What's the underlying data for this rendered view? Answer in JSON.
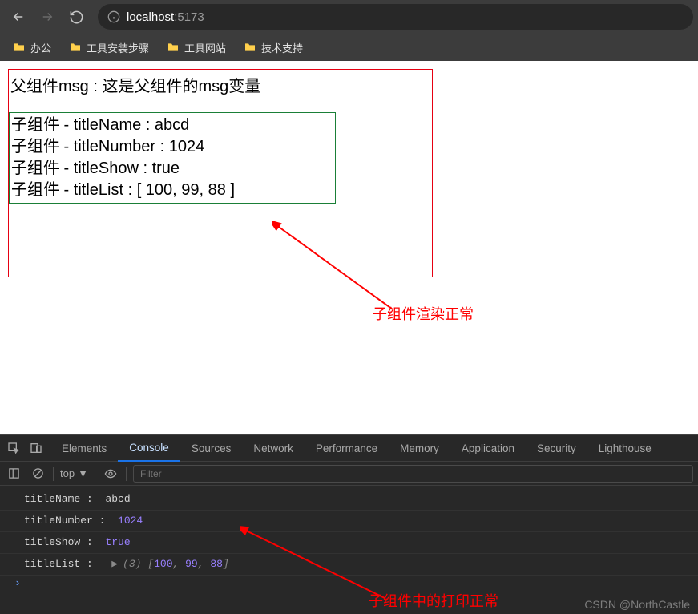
{
  "url": {
    "host": "localhost",
    "port": ":5173"
  },
  "bookmarks": [
    "办公",
    "工具安装步骤",
    "工具网站",
    "技术支持"
  ],
  "page": {
    "parent": "父组件msg : 这是父组件的msg变量",
    "child": {
      "line1": "子组件 - titleName : abcd",
      "line2": "子组件 - titleNumber : 1024",
      "line3": "子组件 - titleShow : true",
      "line4": "子组件 - titleList : [ 100, 99, 88 ]"
    },
    "annot1": "子组件渲染正常"
  },
  "devtools": {
    "tabs": [
      "Elements",
      "Console",
      "Sources",
      "Network",
      "Performance",
      "Memory",
      "Application",
      "Security",
      "Lighthouse"
    ],
    "activeTab": 1,
    "topLabel": "top",
    "filterPlaceholder": "Filter",
    "logs": {
      "r1": {
        "k": "titleName :",
        "v": "abcd"
      },
      "r2": {
        "k": "titleNumber :",
        "v": "1024"
      },
      "r3": {
        "k": "titleShow :",
        "v": "true"
      },
      "r4": {
        "k": "titleList :",
        "len": "(3)",
        "v0": "100",
        "v1": "99",
        "v2": "88"
      }
    },
    "annot2": "子组件中的打印正常",
    "cursor": "›",
    "watermark": "CSDN @NorthCastle"
  }
}
